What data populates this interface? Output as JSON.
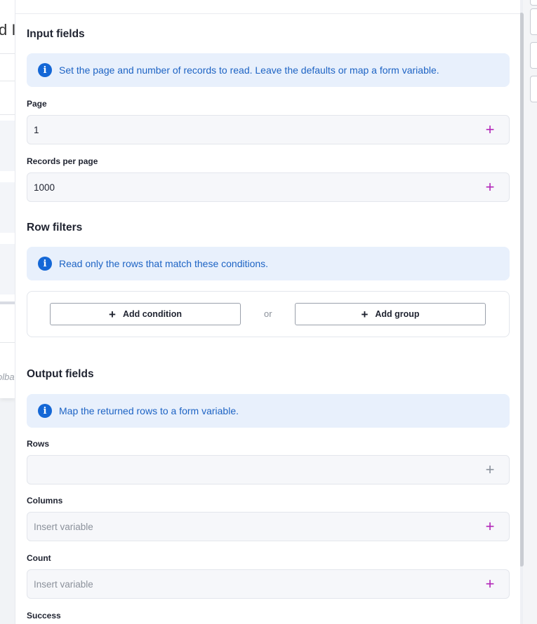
{
  "background": {
    "title_fragment": "d I",
    "toolbar_fragment": "olba"
  },
  "input_fields": {
    "title": "Input fields",
    "info": "Set the page and number of records to read. Leave the defaults or map a form variable.",
    "fields": [
      {
        "label": "Page",
        "value": "1"
      },
      {
        "label": "Records per page",
        "value": "1000"
      }
    ]
  },
  "row_filters": {
    "title": "Row filters",
    "info": "Read only the rows that match these conditions.",
    "add_condition": "Add condition",
    "or": "or",
    "add_group": "Add group"
  },
  "output_fields": {
    "title": "Output fields",
    "info": "Map the returned rows to a form variable.",
    "fields": [
      {
        "label": "Rows",
        "value": ""
      },
      {
        "label": "Columns",
        "placeholder": "Insert variable"
      },
      {
        "label": "Count",
        "placeholder": "Insert variable"
      },
      {
        "label": "Success"
      }
    ]
  },
  "icons": {
    "info": "info-icon",
    "plus": "plus-icon"
  },
  "colors": {
    "accent_plus": "#b224b8",
    "info_bg": "#e8f0fc",
    "info_text": "#1d63c4",
    "info_icon": "#1467d6"
  }
}
